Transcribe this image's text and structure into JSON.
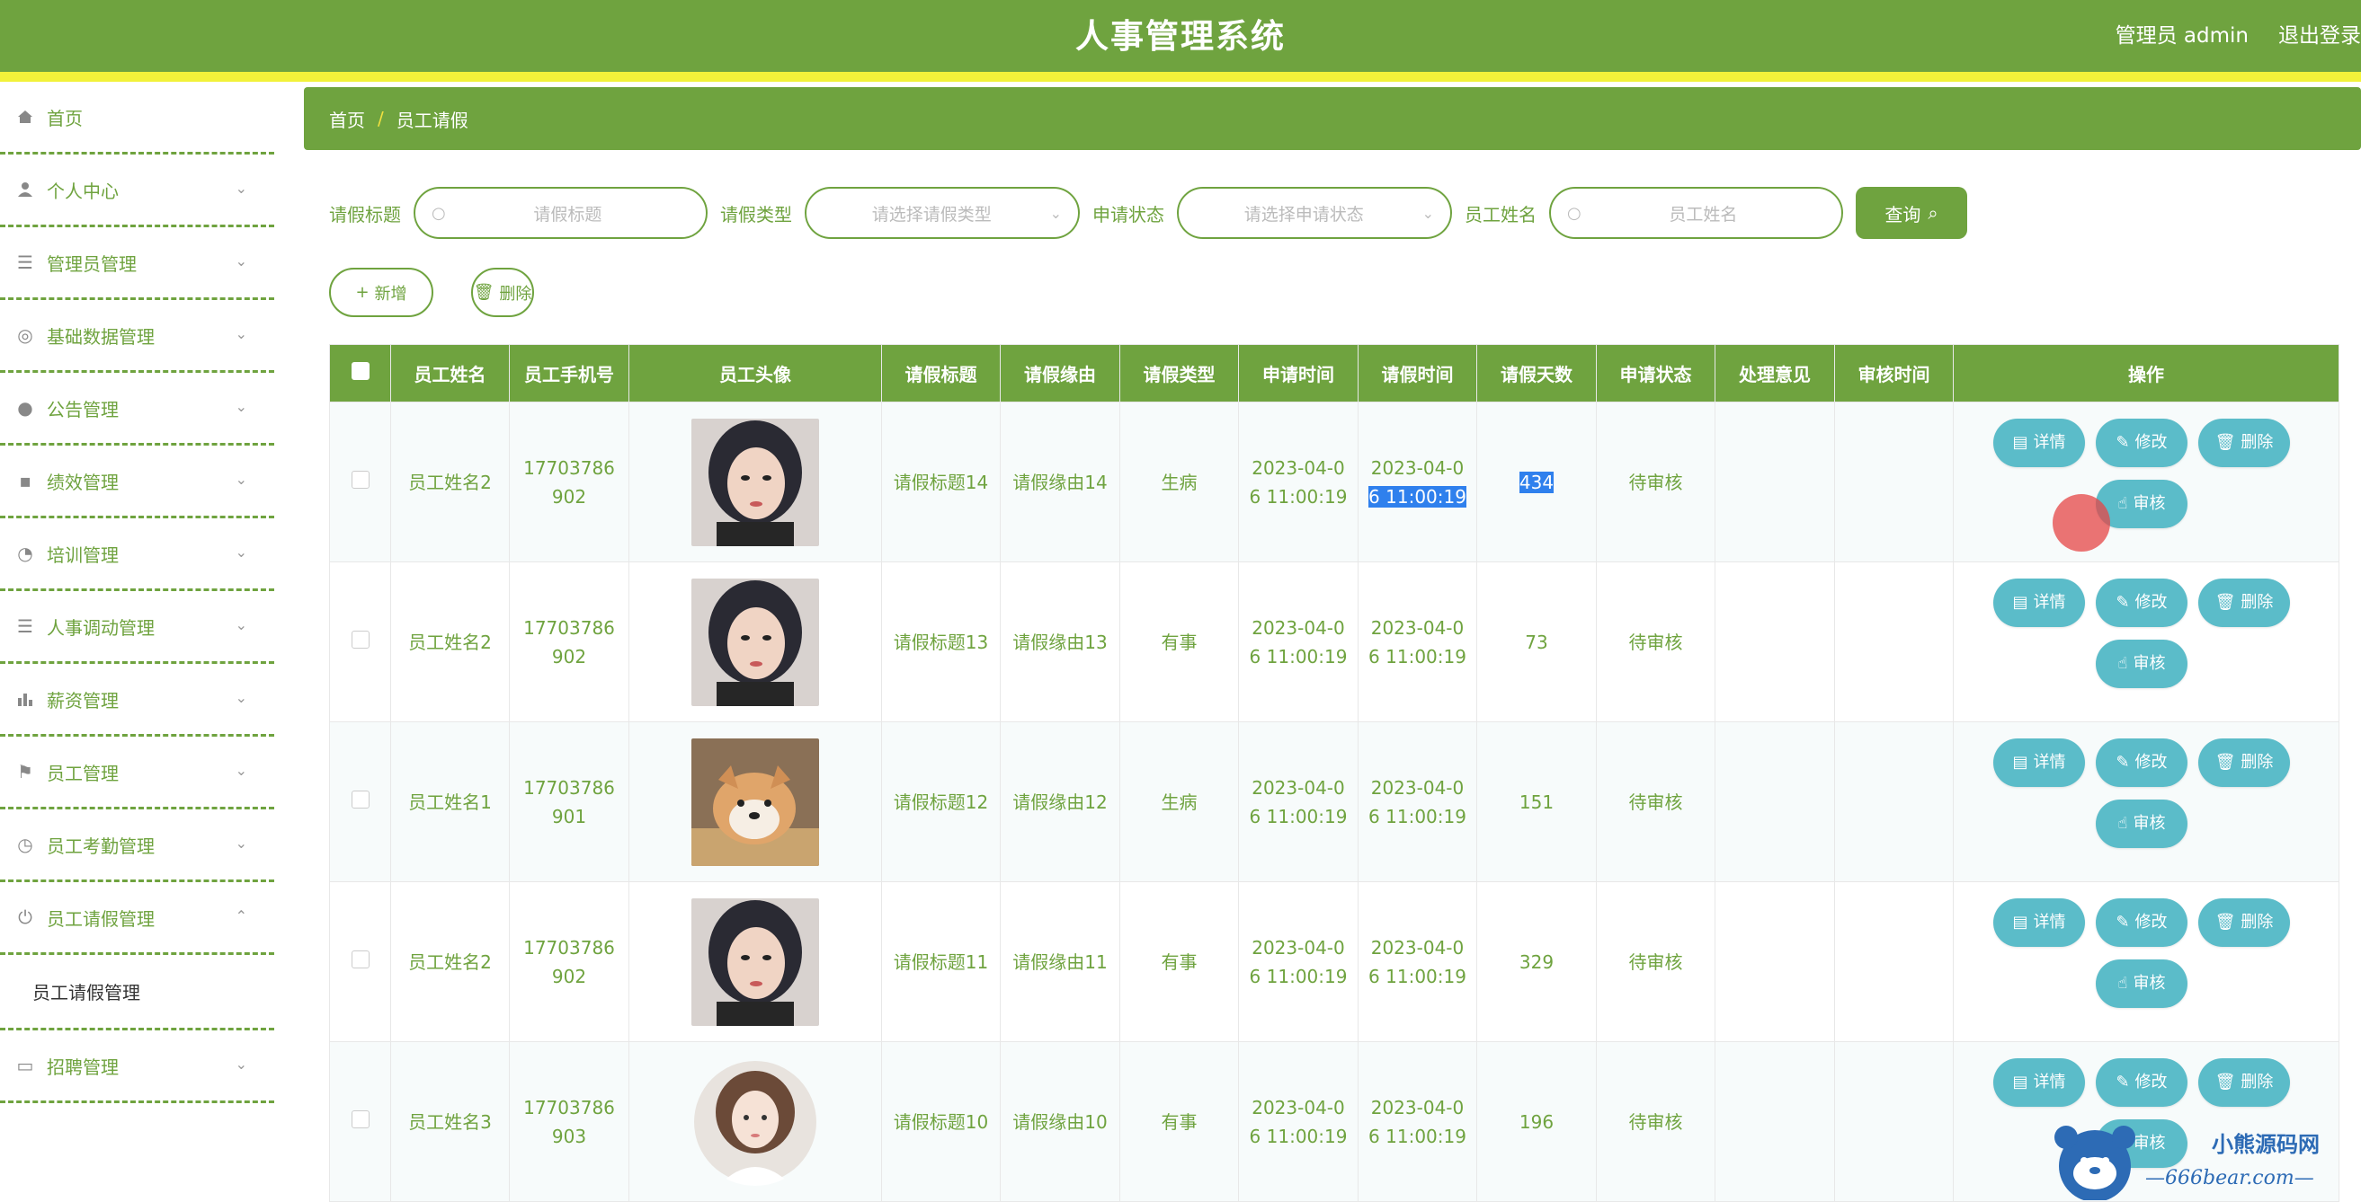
{
  "header": {
    "title": "人事管理系统",
    "user": "管理员 admin",
    "logout": "退出登录"
  },
  "sidebar": {
    "items": [
      {
        "label": "首页",
        "icon": "home-icon"
      },
      {
        "label": "个人中心",
        "icon": "user-icon"
      },
      {
        "label": "管理员管理",
        "icon": "list-icon"
      },
      {
        "label": "基础数据管理",
        "icon": "database-icon"
      },
      {
        "label": "公告管理",
        "icon": "bulb-icon"
      },
      {
        "label": "绩效管理",
        "icon": "chat-icon"
      },
      {
        "label": "培训管理",
        "icon": "compass-icon"
      },
      {
        "label": "人事调动管理",
        "icon": "list-icon"
      },
      {
        "label": "薪资管理",
        "icon": "bar-chart-icon"
      },
      {
        "label": "员工管理",
        "icon": "flag-icon"
      },
      {
        "label": "员工考勤管理",
        "icon": "clock-icon"
      },
      {
        "label": "员工请假管理",
        "icon": "power-icon"
      },
      {
        "label": "招聘管理",
        "icon": "card-icon"
      }
    ],
    "submenu": {
      "label": "员工请假管理"
    }
  },
  "breadcrumb": {
    "home": "首页",
    "separator": "/",
    "current": "员工请假"
  },
  "search": {
    "title_label": "请假标题",
    "title_placeholder": "请假标题",
    "type_label": "请假类型",
    "type_placeholder": "请选择请假类型",
    "status_label": "申请状态",
    "status_placeholder": "请选择申请状态",
    "name_label": "员工姓名",
    "name_placeholder": "员工姓名",
    "query": "查询"
  },
  "actions": {
    "add": "新增",
    "delete": "删除"
  },
  "table": {
    "columns": [
      "员工姓名",
      "员工手机号",
      "员工头像",
      "请假标题",
      "请假缘由",
      "请假类型",
      "申请时间",
      "请假时间",
      "请假天数",
      "申请状态",
      "处理意见",
      "审核时间",
      "操作"
    ],
    "rows": [
      {
        "name": "员工姓名2",
        "phone": [
          "17703786",
          "902"
        ],
        "avatar": "girl-photo",
        "title": "请假标题14",
        "reason": "请假缘由14",
        "type": "生病",
        "apply_time": [
          "2023-04-0",
          "6 11:00:19"
        ],
        "leave_time": [
          "2023-04-0",
          "6 11:00:19"
        ],
        "days": "434",
        "status": "待审核",
        "opinion": "",
        "review_time": ""
      },
      {
        "name": "员工姓名2",
        "phone": [
          "17703786",
          "902"
        ],
        "avatar": "girl-photo",
        "title": "请假标题13",
        "reason": "请假缘由13",
        "type": "有事",
        "apply_time": [
          "2023-04-0",
          "6 11:00:19"
        ],
        "leave_time": [
          "2023-04-0",
          "6 11:00:19"
        ],
        "days": "73",
        "status": "待审核",
        "opinion": "",
        "review_time": ""
      },
      {
        "name": "员工姓名1",
        "phone": [
          "17703786",
          "901"
        ],
        "avatar": "dog-photo",
        "title": "请假标题12",
        "reason": "请假缘由12",
        "type": "生病",
        "apply_time": [
          "2023-04-0",
          "6 11:00:19"
        ],
        "leave_time": [
          "2023-04-0",
          "6 11:00:19"
        ],
        "days": "151",
        "status": "待审核",
        "opinion": "",
        "review_time": ""
      },
      {
        "name": "员工姓名2",
        "phone": [
          "17703786",
          "902"
        ],
        "avatar": "girl-photo",
        "title": "请假标题11",
        "reason": "请假缘由11",
        "type": "有事",
        "apply_time": [
          "2023-04-0",
          "6 11:00:19"
        ],
        "leave_time": [
          "2023-04-0",
          "6 11:00:19"
        ],
        "days": "329",
        "status": "待审核",
        "opinion": "",
        "review_time": ""
      },
      {
        "name": "员工姓名3",
        "phone": [
          "17703786",
          "903"
        ],
        "avatar": "drawn-girl-photo",
        "title": "请假标题10",
        "reason": "请假缘由10",
        "type": "有事",
        "apply_time": [
          "2023-04-0",
          "6 11:00:19"
        ],
        "leave_time": [
          "2023-04-0",
          "6 11:00:19"
        ],
        "days": "196",
        "status": "待审核",
        "opinion": "",
        "review_time": ""
      }
    ],
    "row_actions": {
      "detail": "详情",
      "edit": "修改",
      "delete": "删除",
      "review": "审核"
    }
  },
  "watermark": {
    "text": "小熊源码网",
    "domain": "—666bear.com—"
  },
  "colors": {
    "primary": "#6fa33f",
    "stripe": "#f2f23a",
    "op_button": "#5bbcc9"
  }
}
